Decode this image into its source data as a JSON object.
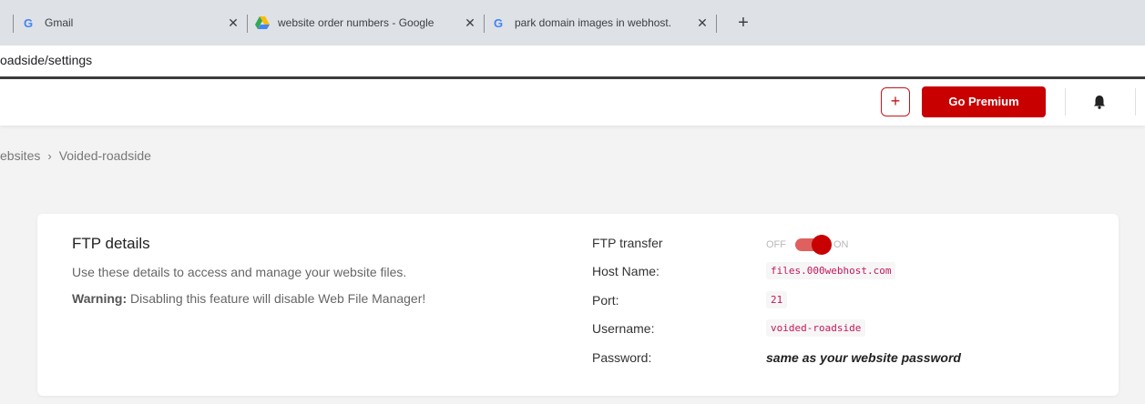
{
  "browser": {
    "tabs": [
      {
        "title": "Gmail",
        "icon": "google-g-icon"
      },
      {
        "title": "website order numbers - Google",
        "icon": "google-drive-icon"
      },
      {
        "title": "park domain images in webhost.",
        "icon": "google-g-icon"
      }
    ],
    "close_glyph": "✕",
    "new_tab_glyph": "+",
    "url": "oadside/settings"
  },
  "header": {
    "plus_label": "+",
    "premium_label": "Go Premium"
  },
  "breadcrumb": {
    "parent": "ebsites",
    "separator": "›",
    "current": "Voided-roadside"
  },
  "ftp": {
    "title": "FTP details",
    "description": "Use these details to access and manage your website files.",
    "warning_label": "Warning:",
    "warning_text": " Disabling this feature will disable Web File Manager!",
    "transfer_label": "FTP transfer",
    "toggle_off": "OFF",
    "toggle_on": "ON",
    "toggle_state": "on",
    "host_label": "Host Name:",
    "host_value": "files.000webhost.com",
    "port_label": "Port:",
    "port_value": "21",
    "username_label": "Username:",
    "username_value": "voided-roadside",
    "password_label": "Password:",
    "password_value": "same as your website password"
  },
  "colors": {
    "brand_red": "#c80000",
    "code_pink": "#c2185b"
  }
}
